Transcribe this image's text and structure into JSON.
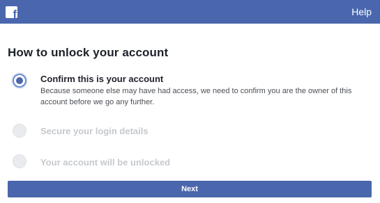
{
  "header": {
    "logo_icon": "facebook-logo-icon",
    "logo_glyph": "f",
    "help_label": "Help",
    "bar_color": "#4a67ad"
  },
  "page": {
    "title": "How to unlock your account"
  },
  "steps": [
    {
      "title": "Confirm this is your account",
      "description": "Because someone else may have had access, we need to confirm you are the owner of this account before we go any further.",
      "state": "active"
    },
    {
      "title": "Secure your login details",
      "state": "inactive"
    },
    {
      "title": "Your account will be unlocked",
      "state": "inactive"
    }
  ],
  "footer": {
    "next_label": "Next"
  }
}
